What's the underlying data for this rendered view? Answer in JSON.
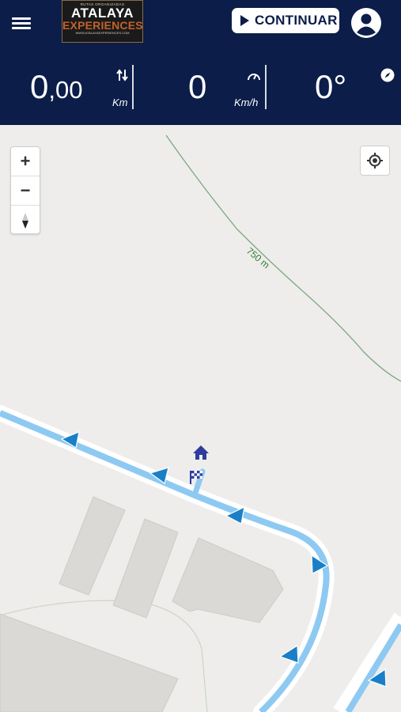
{
  "header": {
    "logo": {
      "tagline": "RUTAS ORGANIZADAS",
      "line1": "ATALAYA",
      "line2": "EXPERIENCES",
      "url": "WWW.ATALAYAEXPERIENCES.COM"
    },
    "continue_label": "CONTINUAR"
  },
  "stats": {
    "distance": {
      "int": "0",
      "dec": ",00",
      "unit": "Km",
      "icon": "route-arrows-icon"
    },
    "speed": {
      "value": "0",
      "unit": "Km/h",
      "icon": "speedometer-icon"
    },
    "heading": {
      "value": "0°",
      "icon": "compass-icon"
    }
  },
  "map": {
    "controls": {
      "zoom_in": "+",
      "zoom_out": "−"
    },
    "contour_label": "750 m",
    "markers": [
      "home-icon",
      "checkered-flag-icon"
    ],
    "colors": {
      "header_bg": "#0b1d48",
      "route": "#8ec9f2",
      "route_arrow": "#1a7fc7",
      "contour": "#7fa77f",
      "marker": "#2f3c9e"
    }
  }
}
